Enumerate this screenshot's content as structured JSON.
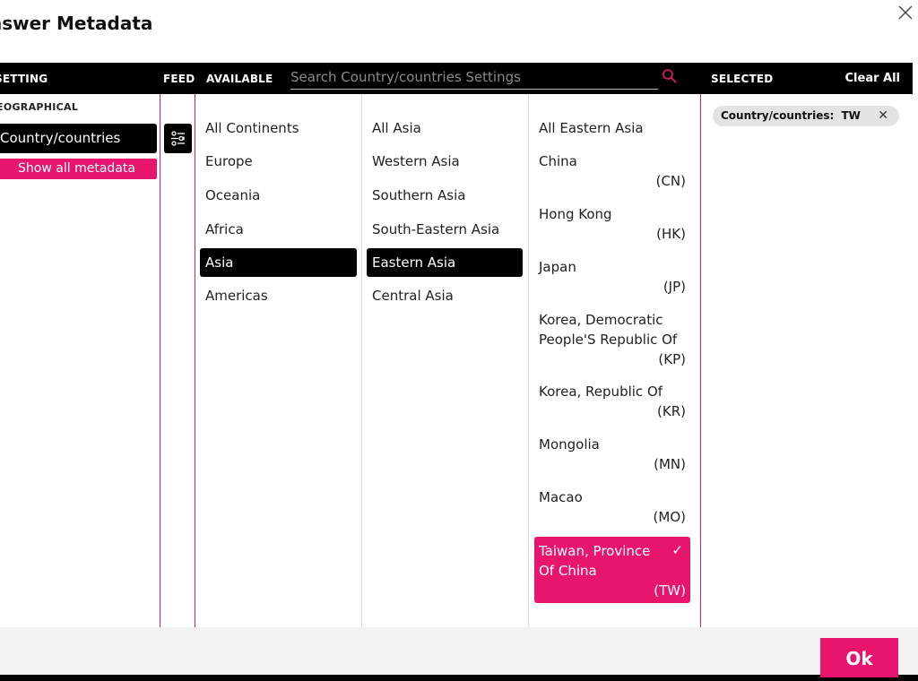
{
  "dialog": {
    "title": "nswer Metadata"
  },
  "header": {
    "setting": "SETTING",
    "feed": "FEED",
    "available": "AVAILABLE",
    "search_placeholder": "Search Country/countries Settings",
    "selected": "SELECTED",
    "clear_all": "Clear All"
  },
  "setting_panel": {
    "group": "EOGRAPHICAL",
    "item": "Country/countries",
    "show_all": "Show all metadata"
  },
  "continents": [
    {
      "label": "All Continents"
    },
    {
      "label": "Europe"
    },
    {
      "label": "Oceania"
    },
    {
      "label": "Africa"
    },
    {
      "label": "Asia",
      "selected": true
    },
    {
      "label": "Americas"
    }
  ],
  "regions": [
    {
      "label": "All Asia"
    },
    {
      "label": "Western Asia"
    },
    {
      "label": "Southern Asia"
    },
    {
      "label": "South-Eastern Asia"
    },
    {
      "label": "Eastern Asia",
      "selected": true
    },
    {
      "label": "Central Asia"
    }
  ],
  "countries": {
    "all": "All Eastern Asia",
    "items": [
      {
        "name": "China",
        "code": "(CN)"
      },
      {
        "name": "Hong Kong",
        "code": "(HK)"
      },
      {
        "name": "Japan",
        "code": "(JP)"
      },
      {
        "name": "Korea, Democratic People'S Republic Of",
        "code": "(KP)"
      },
      {
        "name": "Korea, Republic Of",
        "code": "(KR)"
      },
      {
        "name": "Mongolia",
        "code": "(MN)"
      },
      {
        "name": "Macao",
        "code": "(MO)"
      },
      {
        "name": "Taiwan, Province Of China",
        "code": "(TW)",
        "checked": true
      }
    ]
  },
  "selected_chip": {
    "label": "Country/countries:",
    "value": "TW"
  },
  "footer": {
    "ok": "Ok"
  },
  "colors": {
    "accent": "#e8156e",
    "bar": "#000000",
    "chip": "#e3e3e3"
  },
  "icons": {
    "close": "close-icon",
    "search": "search-icon",
    "feed": "filter-sliders-icon",
    "check": "checkmark-icon"
  }
}
